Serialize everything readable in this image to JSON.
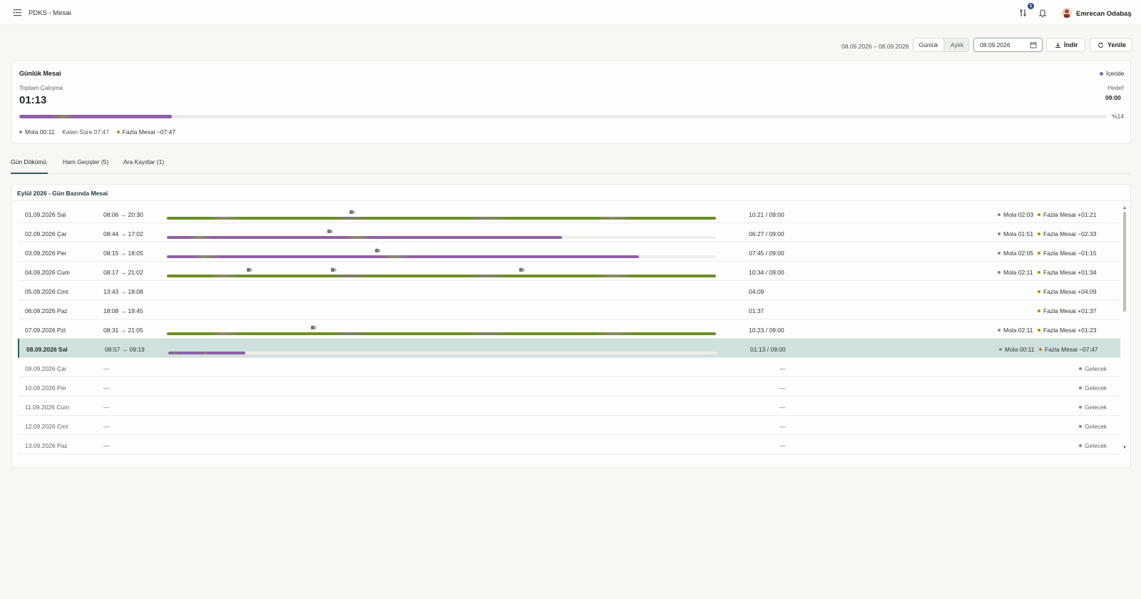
{
  "header": {
    "title": "PDKS - Mesai",
    "user_name": "Emrecan Odabaş",
    "notification_badge": "1"
  },
  "toolbar": {
    "date_range": "08.09.2026 – 08.09.2026",
    "view_options": [
      "Günlük",
      "Aylık"
    ],
    "selected_view": "Günlük",
    "date_value": "08.09.2026",
    "download_label": "İndir",
    "refresh_label": "Yenile"
  },
  "summary": {
    "title": "Günlük Mesai",
    "status": "İçeride",
    "total_label": "Toplam Çalışma",
    "total_value": "01:13",
    "target_label": "Hedef",
    "target_value": "09:00",
    "progress_percent": 14,
    "progress_label": "%14",
    "mola": "Mola 00:11",
    "kalan": "Kalan Süre 07:47",
    "fazla": "Fazla Mesai −07:47"
  },
  "tabs": [
    {
      "label": "Gün Dökümü",
      "active": true
    },
    {
      "label": "Ham Geçişler (5)",
      "active": false
    },
    {
      "label": "Ara Kayıtlar (1)",
      "active": false
    }
  ],
  "table": {
    "title": "Eylül 2026 - Gün Bazında Mesai",
    "rows": [
      {
        "date": "01.09.2026 Sal",
        "time": "08:06 → 20:30",
        "total": "10:21 / 09:00",
        "mola": "Mola 02:03",
        "fazla": "Fazla Mesai +01:21",
        "progress": 1.0,
        "color": "green",
        "breaks": [
          0.337
        ]
      },
      {
        "date": "02.09.2026 Çar",
        "time": "08:44 → 17:02",
        "total": "06:27 / 09:00",
        "mola": "Mola 01:51",
        "fazla": "Fazla Mesai −02:33",
        "progress": 0.72,
        "color": "purple",
        "breaks": [
          0.296
        ]
      },
      {
        "date": "03.09.2026 Per",
        "time": "08:15 → 18:05",
        "total": "07:45 / 09:00",
        "mola": "Mola 02:05",
        "fazla": "Fazla Mesai −01:15",
        "progress": 0.86,
        "color": "purple",
        "breaks": [
          0.383
        ]
      },
      {
        "date": "04.09.2026 Cum",
        "time": "08:17 → 21:02",
        "total": "10:34 / 09:00",
        "mola": "Mola 02:11",
        "fazla": "Fazla Mesai +01:34",
        "progress": 1.0,
        "color": "green",
        "breaks": [
          0.149,
          0.303,
          0.646
        ]
      },
      {
        "date": "05.09.2026 Cmt",
        "time": "13:43 → 18:08",
        "total": "04:09",
        "mola": "",
        "fazla": "Fazla Mesai +04:09",
        "progress": 0,
        "color": "",
        "breaks": []
      },
      {
        "date": "06.09.2026 Paz",
        "time": "18:08 → 19:45",
        "total": "01:37",
        "mola": "",
        "fazla": "Fazla Mesai +01:37",
        "progress": 0,
        "color": "",
        "breaks": []
      },
      {
        "date": "07.09.2026 Pzt",
        "time": "08:31 → 21:05",
        "total": "10:23 / 09:00",
        "mola": "Mola 02:11",
        "fazla": "Fazla Mesai +01:23",
        "progress": 1.0,
        "color": "green",
        "breaks": [
          0.266
        ]
      },
      {
        "date": "08.09.2026 Sal",
        "time": "08:57 → 09:19",
        "total": "01:13 / 09:00",
        "mola": "Mola 00:11",
        "fazla": "Fazla Mesai −07:47",
        "progress": 0.14,
        "color": "purple",
        "breaks": [],
        "selected": true
      },
      {
        "date": "09.09.2026 Çar",
        "time": "—",
        "total": "—",
        "status": "Gelecek",
        "future": true
      },
      {
        "date": "10.09.2026 Per",
        "time": "—",
        "total": "—",
        "status": "Gelecek",
        "future": true
      },
      {
        "date": "11.09.2026 Cum",
        "time": "—",
        "total": "—",
        "status": "Gelecek",
        "future": true
      },
      {
        "date": "12.09.2026 Cmt",
        "time": "—",
        "total": "—",
        "status": "Gelecek",
        "future": true
      },
      {
        "date": "13.09.2026 Paz",
        "time": "—",
        "total": "—",
        "status": "Gelecek",
        "future": true
      }
    ]
  },
  "colors": {
    "accent": "#2f5f55",
    "overtime_dot": "#b8860b",
    "break_dot": "#888888",
    "green_bar": "#6b8e23",
    "purple_bar": "#8e5fa6",
    "selected_row": "#cfe1dc"
  },
  "icons": [
    "menu-icon",
    "filter-icon",
    "bell-icon",
    "download-icon",
    "refresh-icon",
    "calendar-icon",
    "coffee-icon"
  ]
}
